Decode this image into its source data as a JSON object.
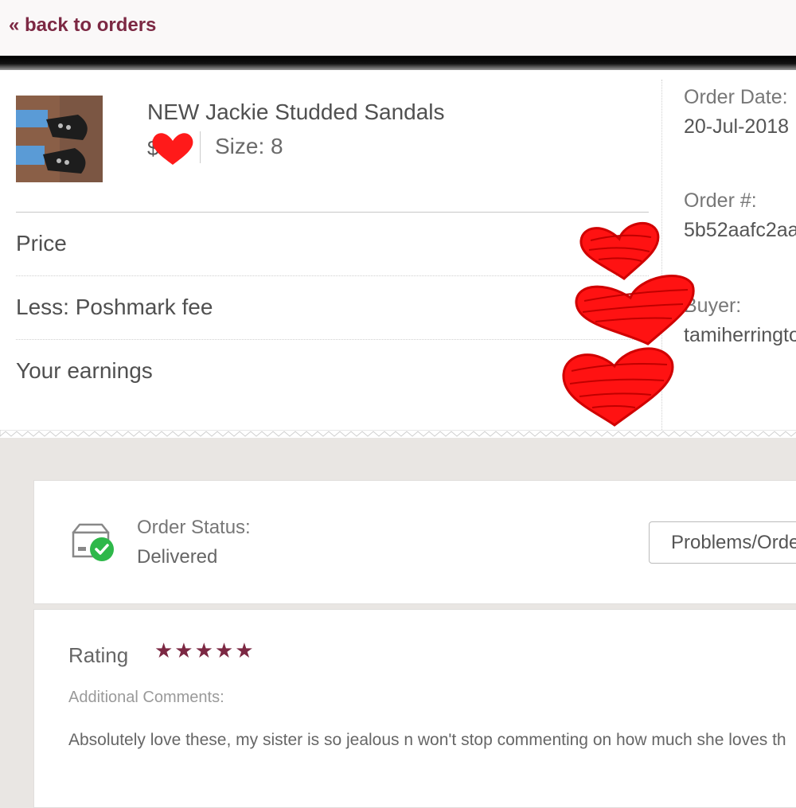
{
  "nav": {
    "back_link": "« back to orders"
  },
  "order": {
    "product_title": "NEW Jackie Studded Sandals",
    "size": "Size: 8",
    "rows": [
      {
        "label": "Price"
      },
      {
        "label": "Less: Poshmark fee"
      },
      {
        "label": "Your earnings"
      }
    ],
    "order_date_label": "Order Date:",
    "order_date": "20-Jul-2018",
    "order_number_label": "Order #:",
    "order_number": "5b52aafc2aa",
    "buyer_label": "Buyer:",
    "buyer": "tamiherringto"
  },
  "status": {
    "label": "Order Status:",
    "value": "Delivered",
    "problems_button": "Problems/Orde",
    "icon": "box-check-icon"
  },
  "review": {
    "rating_label": "Rating",
    "stars": "★★★★★",
    "rating": 5,
    "rating_max": 5,
    "comments_label": "Additional Comments:",
    "comment": "Absolutely love these, my sister is so jealous n won't stop commenting on how much she loves th"
  },
  "colors": {
    "accent": "#7c2843",
    "redaction": "#ff0000",
    "success": "#2eb84a",
    "page_bg": "#e9e6e3"
  }
}
